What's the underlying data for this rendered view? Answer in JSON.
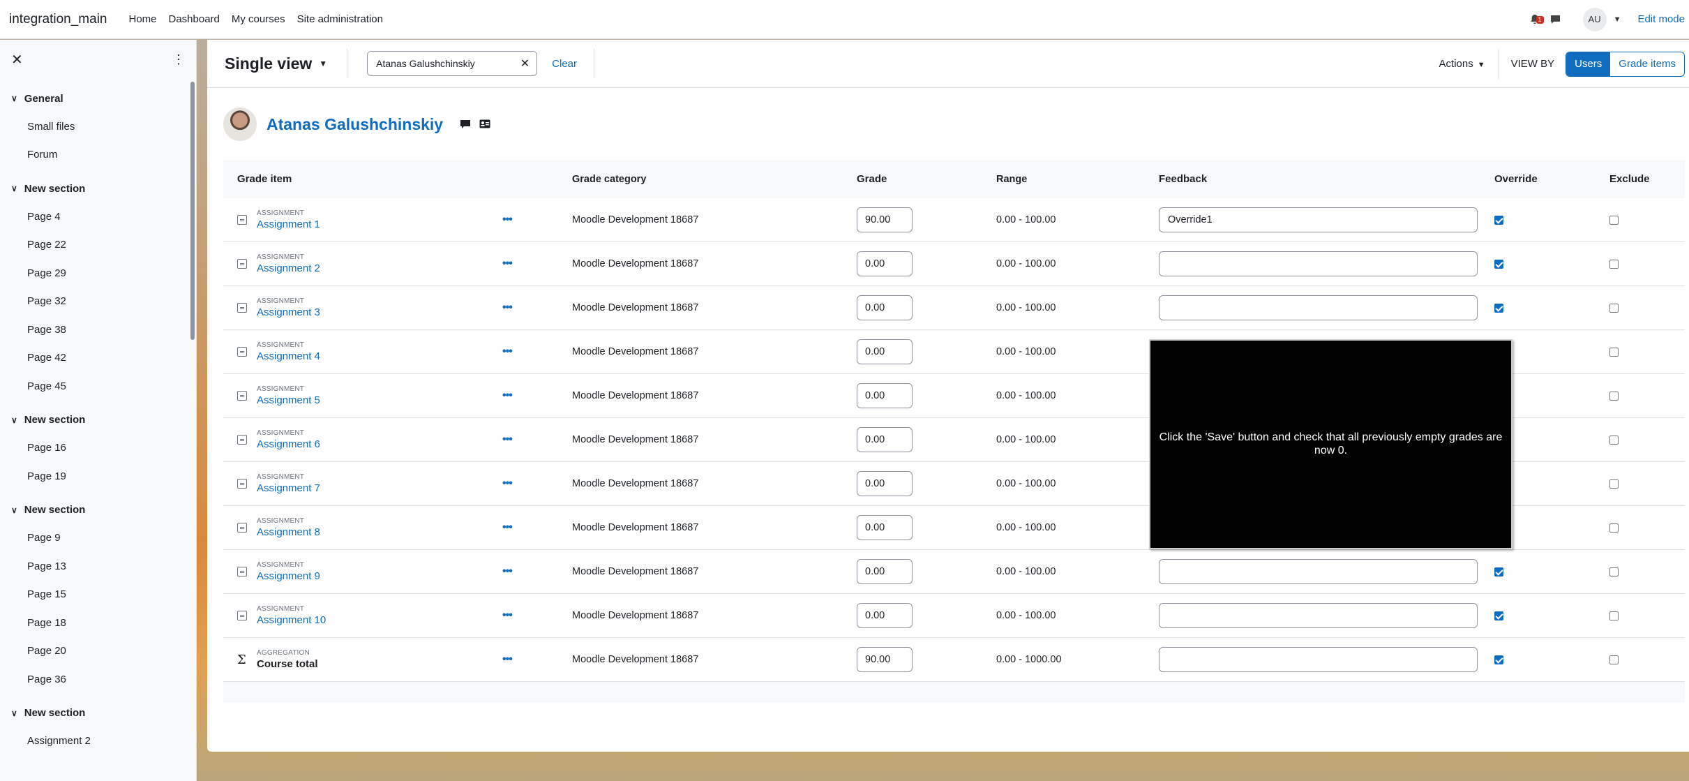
{
  "navbar": {
    "brand": "integration_main",
    "links": [
      "Home",
      "Dashboard",
      "My courses",
      "Site administration"
    ],
    "notification_count": "1",
    "user_initials": "AU",
    "edit_mode_label": "Edit mode"
  },
  "drawer": {
    "sections": [
      {
        "title": "General",
        "items": [
          "Small files",
          "Forum"
        ]
      },
      {
        "title": "New section",
        "items": [
          "Page 4",
          "Page 22",
          "Page 29",
          "Page 32",
          "Page 38",
          "Page 42",
          "Page 45"
        ]
      },
      {
        "title": "New section",
        "items": [
          "Page 16",
          "Page 19"
        ]
      },
      {
        "title": "New section",
        "items": [
          "Page 9",
          "Page 13",
          "Page 15",
          "Page 18",
          "Page 20",
          "Page 36"
        ]
      },
      {
        "title": "New section",
        "items": [
          "Assignment 2"
        ]
      }
    ]
  },
  "toolbar": {
    "title": "Single view",
    "search_value": "Atanas Galushchinskiy",
    "clear_label": "Clear",
    "actions_label": "Actions",
    "view_by_label": "VIEW BY",
    "view_users": "Users",
    "view_grade_items": "Grade items"
  },
  "user": {
    "name": "Atanas Galushchinskiy"
  },
  "table": {
    "headers": {
      "item": "Grade item",
      "category": "Grade category",
      "grade": "Grade",
      "range": "Range",
      "feedback": "Feedback",
      "override": "Override",
      "exclude": "Exclude"
    },
    "rows": [
      {
        "type": "ASSIGNMENT",
        "name": "Assignment 1",
        "category": "Moodle Development 18687",
        "grade": "90.00",
        "range": "0.00 - 100.00",
        "feedback": "Override1",
        "override": true,
        "exclude": false
      },
      {
        "type": "ASSIGNMENT",
        "name": "Assignment 2",
        "category": "Moodle Development 18687",
        "grade": "0.00",
        "range": "0.00 - 100.00",
        "feedback": "",
        "override": true,
        "exclude": false
      },
      {
        "type": "ASSIGNMENT",
        "name": "Assignment 3",
        "category": "Moodle Development 18687",
        "grade": "0.00",
        "range": "0.00 - 100.00",
        "feedback": "",
        "override": true,
        "exclude": false
      },
      {
        "type": "ASSIGNMENT",
        "name": "Assignment 4",
        "category": "Moodle Development 18687",
        "grade": "0.00",
        "range": "0.00 - 100.00",
        "feedback": "",
        "override": false,
        "exclude": false
      },
      {
        "type": "ASSIGNMENT",
        "name": "Assignment 5",
        "category": "Moodle Development 18687",
        "grade": "0.00",
        "range": "0.00 - 100.00",
        "feedback": "",
        "override": false,
        "exclude": false
      },
      {
        "type": "ASSIGNMENT",
        "name": "Assignment 6",
        "category": "Moodle Development 18687",
        "grade": "0.00",
        "range": "0.00 - 100.00",
        "feedback": "",
        "override": false,
        "exclude": false
      },
      {
        "type": "ASSIGNMENT",
        "name": "Assignment 7",
        "category": "Moodle Development 18687",
        "grade": "0.00",
        "range": "0.00 - 100.00",
        "feedback": "",
        "override": false,
        "exclude": false
      },
      {
        "type": "ASSIGNMENT",
        "name": "Assignment 8",
        "category": "Moodle Development 18687",
        "grade": "0.00",
        "range": "0.00 - 100.00",
        "feedback": "",
        "override": false,
        "exclude": false
      },
      {
        "type": "ASSIGNMENT",
        "name": "Assignment 9",
        "category": "Moodle Development 18687",
        "grade": "0.00",
        "range": "0.00 - 100.00",
        "feedback": "",
        "override": true,
        "exclude": false
      },
      {
        "type": "ASSIGNMENT",
        "name": "Assignment 10",
        "category": "Moodle Development 18687",
        "grade": "0.00",
        "range": "0.00 - 100.00",
        "feedback": "",
        "override": true,
        "exclude": false
      },
      {
        "type": "AGGREGATION",
        "name": "Course total",
        "category": "Moodle Development 18687",
        "grade": "90.00",
        "range": "0.00 - 1000.00",
        "feedback": "",
        "override": true,
        "exclude": false,
        "is_total": true
      }
    ]
  },
  "overlay": {
    "message": "Click the 'Save' button and check that all previously empty grades are now 0."
  }
}
